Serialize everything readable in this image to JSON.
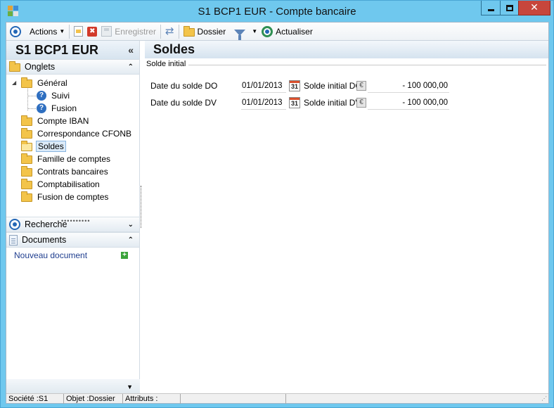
{
  "window": {
    "title": "S1 BCP1 EUR -  Compte bancaire",
    "close_glyph": "✕"
  },
  "toolbar": {
    "actions_label": "Actions",
    "save_label": "Enregistrer",
    "dossier_label": "Dossier",
    "actualiser_label": "Actualiser",
    "delete_glyph": "✖",
    "refresh_glyph": "⇄"
  },
  "left": {
    "title": "S1 BCP1 EUR",
    "collapse_glyph": "«",
    "onglets_label": "Onglets",
    "recherche_label": "Recherche",
    "documents_label": "Documents",
    "chevron_up": "⌃",
    "chevron_down": "⌄",
    "tree": [
      {
        "label": "Général"
      },
      {
        "label": "Suivi"
      },
      {
        "label": "Fusion"
      },
      {
        "label": "Compte IBAN"
      },
      {
        "label": "Correspondance CFONB"
      },
      {
        "label": "Soldes",
        "selected": true
      },
      {
        "label": "Famille de comptes"
      },
      {
        "label": "Contrats bancaires"
      },
      {
        "label": "Comptabilisation"
      },
      {
        "label": "Fusion de comptes"
      }
    ],
    "new_document_label": "Nouveau document",
    "footer_glyph": "▼"
  },
  "main": {
    "title": "Soldes",
    "group_label": "Solde initial",
    "calendar_glyph": "31",
    "euro_glyph": "€",
    "rows": [
      {
        "date_label": "Date du solde DO",
        "date_value": "01/01/2013",
        "init_label": "Solde initial DO",
        "amount": "- 100 000,00"
      },
      {
        "date_label": "Date du solde DV",
        "date_value": "01/01/2013",
        "init_label": "Solde initial DV",
        "amount": "- 100 000,00"
      }
    ]
  },
  "status": {
    "societe": "Société :S1",
    "objet": "Objet :Dossier",
    "attributs": "Attributs :"
  },
  "colors": {
    "titlebar": "#6fc8ee",
    "close_button": "#c7463c",
    "selection": "#dbeaf8"
  }
}
